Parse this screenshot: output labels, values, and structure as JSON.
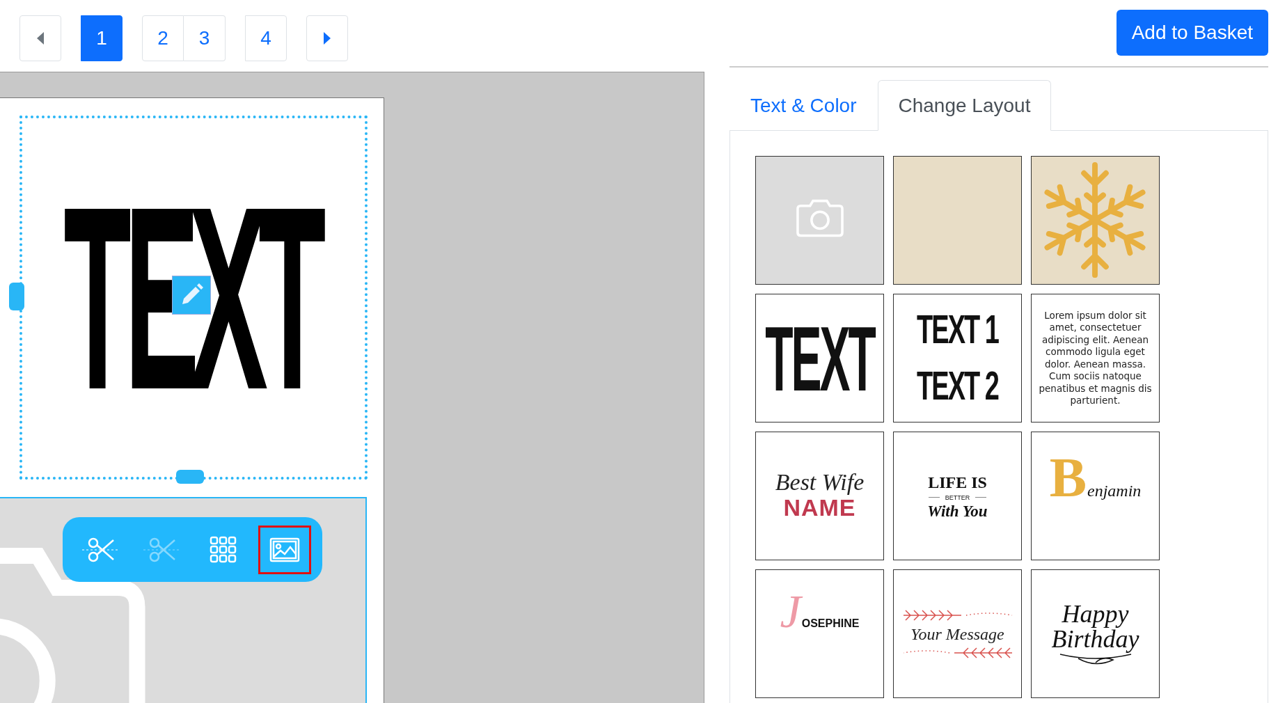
{
  "pagination": {
    "prev": {
      "disabled": true
    },
    "next": {
      "disabled": false
    },
    "page_groups": [
      {
        "pages": [
          {
            "label": "1",
            "selected": true
          }
        ]
      },
      {
        "pages": [
          {
            "label": "2",
            "selected": false
          },
          {
            "label": "3",
            "selected": false
          }
        ]
      },
      {
        "pages": [
          {
            "label": "4",
            "selected": false
          }
        ]
      }
    ]
  },
  "add_button": "Add to Basket",
  "canvas": {
    "text": "TEXT",
    "tools": [
      {
        "kind": "cut",
        "disabled": false,
        "selected": false
      },
      {
        "kind": "cut",
        "disabled": true,
        "selected": false
      },
      {
        "kind": "grid",
        "disabled": false,
        "selected": false
      },
      {
        "kind": "image",
        "disabled": false,
        "selected": true
      }
    ]
  },
  "tabs": [
    {
      "label": "Text & Color",
      "selected": false
    },
    {
      "label": "Change Layout",
      "selected": true
    }
  ],
  "layouts": [
    {
      "kind": "photo"
    },
    {
      "kind": "plain"
    },
    {
      "kind": "snowflake"
    },
    {
      "kind": "text",
      "lines": [
        "TEXT"
      ]
    },
    {
      "kind": "two-lines",
      "lines": [
        "TEXT 1",
        "TEXT 2"
      ]
    },
    {
      "kind": "paragraph",
      "lines": [
        "Lorem ipsum dolor sit amet, consectetuer adipiscing elit. Aenean commodo ligula eget dolor. Aenean massa. Cum sociis natoque penatibus et magnis dis parturient."
      ]
    },
    {
      "kind": "best-wife",
      "lines": [
        "Best Wife",
        "NAME"
      ]
    },
    {
      "kind": "life-is",
      "lines": [
        "LIFE IS",
        "BETTER",
        "With You"
      ]
    },
    {
      "kind": "initial",
      "lines": [
        "B",
        "enjamin"
      ]
    },
    {
      "kind": "initial-pink",
      "lines": [
        "J",
        "OSEPHINE"
      ]
    },
    {
      "kind": "message",
      "lines": [
        "Your Message"
      ]
    },
    {
      "kind": "birthday",
      "lines": [
        "Happy",
        "Birthday"
      ]
    }
  ]
}
